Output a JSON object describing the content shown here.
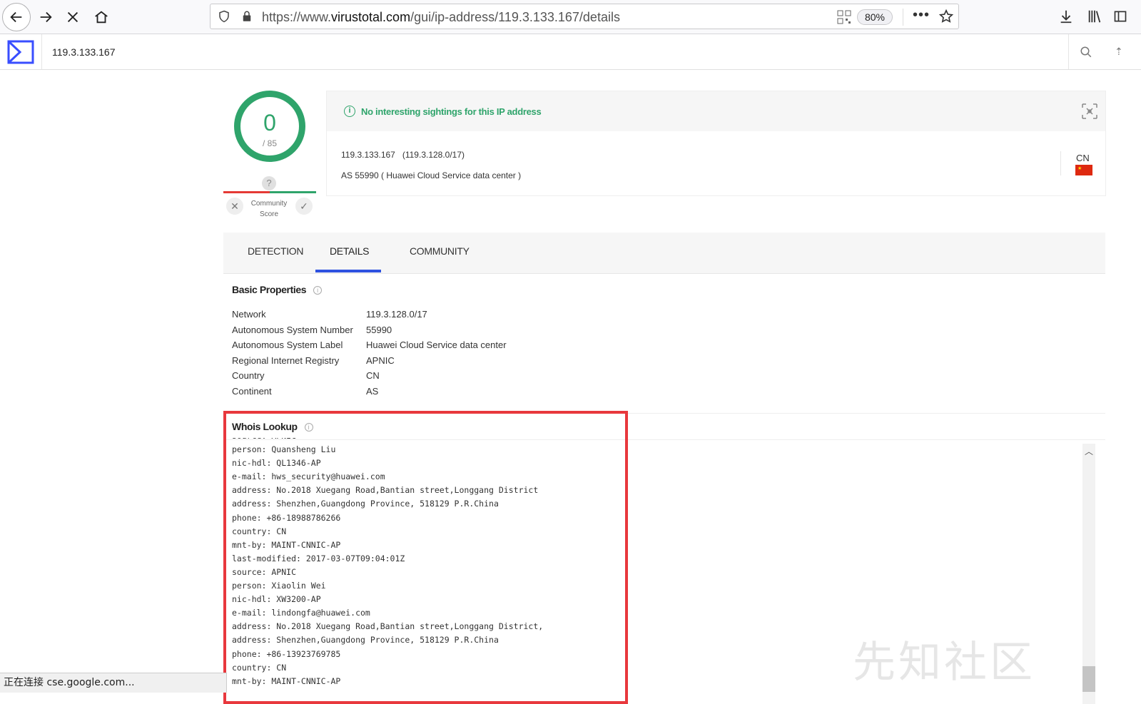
{
  "browser": {
    "url_prefix": "https://www.",
    "url_domain": "virustotal.com",
    "url_path": "/gui/ip-address/119.3.133.167/details",
    "zoom": "80%"
  },
  "header": {
    "search_value": "119.3.133.167"
  },
  "score": {
    "detections": "0",
    "total": "/ 85",
    "community_unknown": "?",
    "community_label_1": "Community",
    "community_label_2": "Score"
  },
  "sightings": {
    "message": "No interesting sightings for this IP address",
    "ip_line": "119.3.133.167   (119.3.128.0/17)",
    "as_line": "AS 55990 ( Huawei Cloud Service data center )",
    "country_code": "CN"
  },
  "tabs": [
    {
      "label": "DETECTION",
      "active": false
    },
    {
      "label": "DETAILS",
      "active": true
    },
    {
      "label": "COMMUNITY",
      "active": false
    }
  ],
  "basic_properties": {
    "title": "Basic Properties",
    "rows": [
      {
        "key": "Network",
        "value": "119.3.128.0/17"
      },
      {
        "key": "Autonomous System Number",
        "value": "55990"
      },
      {
        "key": "Autonomous System Label",
        "value": "Huawei Cloud Service data center"
      },
      {
        "key": "Regional Internet Registry",
        "value": "APNIC"
      },
      {
        "key": "Country",
        "value": "CN"
      },
      {
        "key": "Continent",
        "value": "AS"
      }
    ]
  },
  "whois": {
    "title": "Whois Lookup",
    "lines": [
      "source: APNIC",
      "person: Quansheng Liu",
      "nic-hdl: QL1346-AP",
      "e-mail: hws_security@huawei.com",
      "address: No.2018 Xuegang Road,Bantian street,Longgang District",
      "address: Shenzhen,Guangdong Province, 518129 P.R.China",
      "phone: +86-18988786266",
      "country: CN",
      "mnt-by: MAINT-CNNIC-AP",
      "last-modified: 2017-03-07T09:04:01Z",
      "source: APNIC",
      "person: Xiaolin Wei",
      "nic-hdl: XW3200-AP",
      "e-mail: lindongfa@huawei.com",
      "address: No.2018 Xuegang Road,Bantian street,Longgang District,",
      "address: Shenzhen,Guangdong Province, 518129 P.R.China",
      "phone: +86-13923769785",
      "country: CN",
      "mnt-by: MAINT-CNNIC-AP"
    ]
  },
  "status_bar": "正在连接 cse.google.com...",
  "watermark": "先知社区",
  "colors": {
    "score_green": "#2fa46b",
    "tab_accent": "#2f52e0",
    "highlight_red": "#e8383d"
  }
}
